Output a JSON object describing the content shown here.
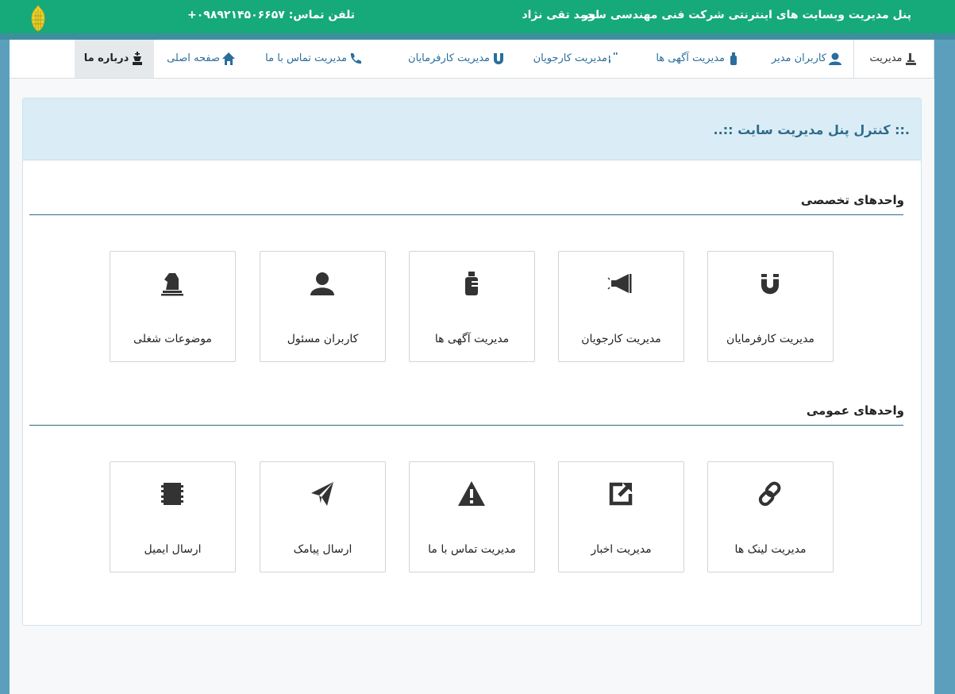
{
  "header": {
    "title": "پنل مدیریت وبسایت های اینترنتی شرکت فنی مهندسی سور",
    "user": "احمد تقی نژاد",
    "phone": "تلفن تماس: ۰۹۸۹۲۱۴۵۰۶۶۵۷+"
  },
  "nav": {
    "items": [
      {
        "label": "مدیریت",
        "icon": "admin-icon"
      },
      {
        "label": "کاربران مدیر",
        "icon": "user-icon"
      },
      {
        "label": "مدیریت آگهی ها",
        "icon": "bottle-icon"
      },
      {
        "label": "مدیریت کارجویان",
        "icon": "bitcoin-icon"
      },
      {
        "label": "مدیریت کارفرمایان",
        "icon": "magnet-icon"
      },
      {
        "label": "مدیریت تماس با ما",
        "icon": "phone-icon"
      },
      {
        "label": "صفحه اصلی",
        "icon": "home-icon"
      },
      {
        "label": "درباره ما",
        "icon": "king-icon"
      }
    ]
  },
  "panel": {
    "title": ".:: کنترل پنل مدیریت سایت ::.."
  },
  "sections": [
    {
      "title": "واحدهای تخصصی",
      "tiles": [
        {
          "label": "مدیریت کارفرمایان",
          "icon": "magnet-icon"
        },
        {
          "label": "مدیریت کارجویان",
          "icon": "bullhorn-icon"
        },
        {
          "label": "مدیریت آگهی ها",
          "icon": "bottle-icon"
        },
        {
          "label": "کاربران مسئول",
          "icon": "user-icon"
        },
        {
          "label": "موضوعات شغلی",
          "icon": "knight-icon"
        }
      ]
    },
    {
      "title": "واحدهای عمومی",
      "tiles": [
        {
          "label": "مدیریت لینک ها",
          "icon": "link-icon"
        },
        {
          "label": "مدیریت اخبار",
          "icon": "share-icon"
        },
        {
          "label": "مدیریت تماس با ما",
          "icon": "warning-icon"
        },
        {
          "label": "ارسال پیامک",
          "icon": "send-icon"
        },
        {
          "label": "ارسال ایمیل",
          "icon": "chip-icon"
        }
      ]
    }
  ],
  "colors": {
    "header_bg": "#16a97a",
    "body_bg": "#5c9fbc",
    "panel_head_bg": "#daedf6",
    "link": "#2a6e9c"
  }
}
